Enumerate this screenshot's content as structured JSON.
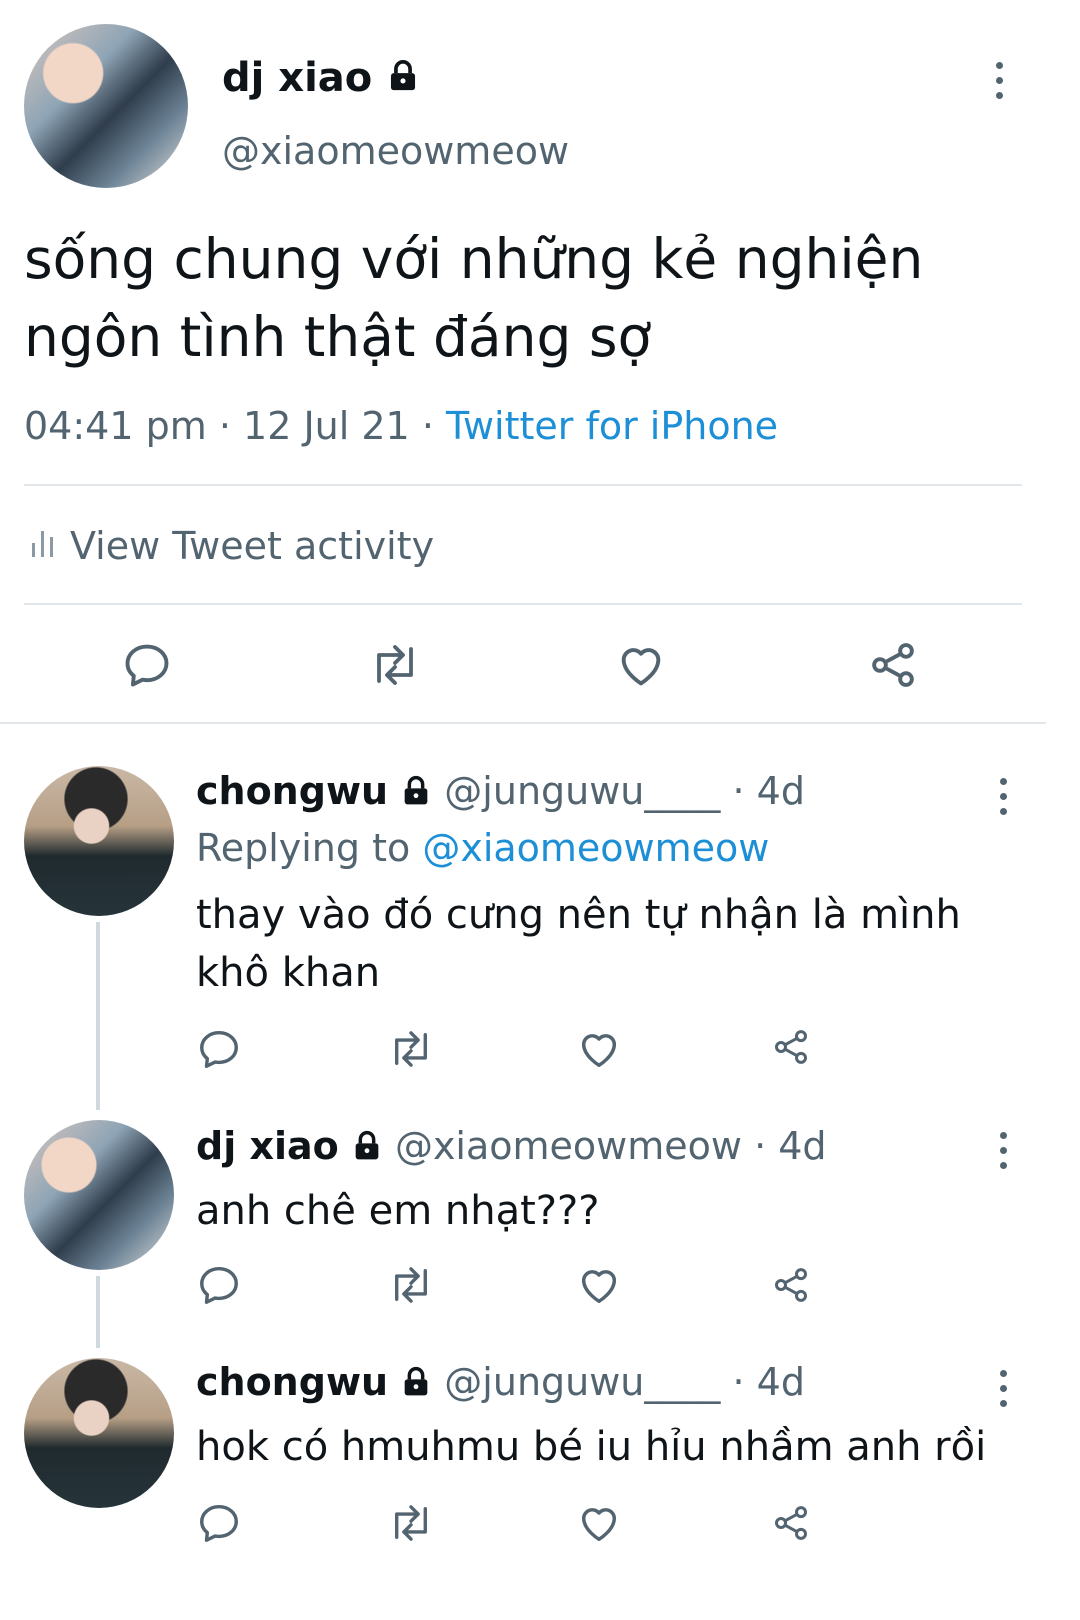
{
  "main_tweet": {
    "display_name": "dj xiao",
    "handle": "@xiaomeowmeow",
    "text_line1": "sống chung với những kẻ nghiện",
    "text_line2": "ngôn tình thật đáng sợ",
    "time": "04:41 pm",
    "date": "12 Jul 21",
    "source": "Twitter for iPhone",
    "activity_label": "View Tweet activity"
  },
  "replies": [
    {
      "display_name": "chongwu",
      "handle": "@junguwu____",
      "age": "4d",
      "replying_prefix": "Replying to",
      "replying_handle": "@xiaomeowmeow",
      "text_line1": "thay vào đó cưng nên tự nhận là mình",
      "text_line2": "khô khan"
    },
    {
      "display_name": "dj xiao",
      "handle": "@xiaomeowmeow",
      "age": "4d",
      "text_line1": "anh chê em nhạt???"
    },
    {
      "display_name": "chongwu",
      "handle": "@junguwu____",
      "age": "4d",
      "text_line1": "hok có hmuhmu bé iu hỉu nhầm anh rồi"
    }
  ],
  "separator": "·",
  "icons": {
    "reply": "speech-bubble-icon",
    "retweet": "retweet-icon",
    "like": "heart-icon",
    "share": "share-icon",
    "more": "more-vertical-icon",
    "lock": "lock-icon",
    "activity": "bar-chart-icon"
  },
  "colors": {
    "link": "#1d8fd6",
    "secondary_text": "#536471",
    "divider": "#e1e6ea"
  }
}
